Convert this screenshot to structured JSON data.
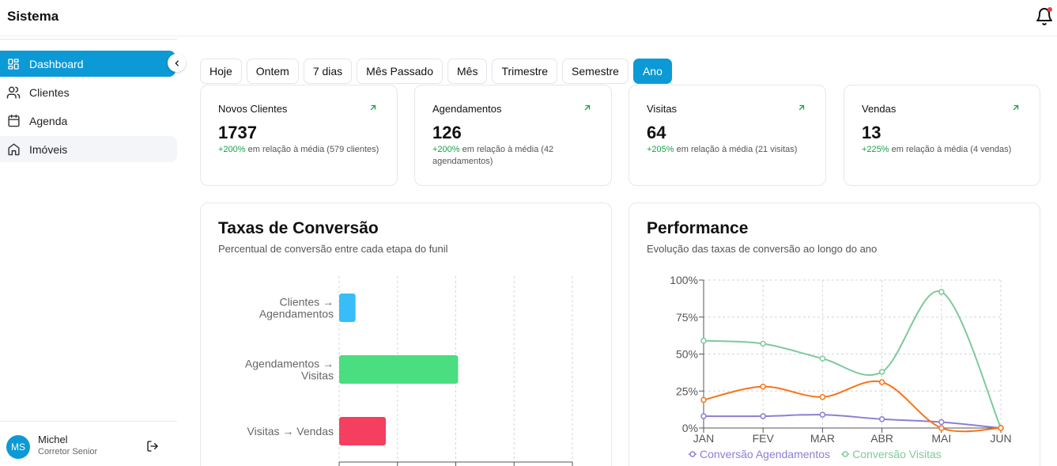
{
  "app": {
    "title": "Sistema"
  },
  "sidebar": {
    "items": [
      {
        "label": "Dashboard",
        "icon": "dashboard-icon",
        "active": true
      },
      {
        "label": "Clientes",
        "icon": "users-icon",
        "active": false
      },
      {
        "label": "Agenda",
        "icon": "calendar-icon",
        "active": false
      },
      {
        "label": "Imóveis",
        "icon": "home-icon",
        "active": false
      }
    ],
    "user": {
      "initials": "MS",
      "name": "Michel",
      "role": "Corretor Senior"
    }
  },
  "filters": {
    "items": [
      "Hoje",
      "Ontem",
      "7 dias",
      "Mês Passado",
      "Mês",
      "Trimestre",
      "Semestre",
      "Ano"
    ],
    "active": "Ano"
  },
  "stats": [
    {
      "title": "Novos Clientes",
      "value": "1737",
      "change": "+200%",
      "note": " em relação à média (579 clientes)"
    },
    {
      "title": "Agendamentos",
      "value": "126",
      "change": "+200%",
      "note": " em relação à média (42 agendamentos)"
    },
    {
      "title": "Visitas",
      "value": "64",
      "change": "+205%",
      "note": " em relação à média (21 visitas)"
    },
    {
      "title": "Vendas",
      "value": "13",
      "change": "+225%",
      "note": " em relação à média (4 vendas)"
    }
  ],
  "conversion": {
    "title": "Taxas de Conversão",
    "subtitle": "Percentual de conversão entre cada etapa do funil"
  },
  "performance": {
    "title": "Performance",
    "subtitle": "Evolução das taxas de conversão ao longo do ano"
  },
  "colors": {
    "accent": "#0b9ad6",
    "positive": "#16a34a"
  },
  "chart_data": [
    {
      "type": "bar",
      "orientation": "horizontal",
      "categories": [
        [
          "Clientes →",
          "Agendamentos"
        ],
        [
          "Agendamentos →",
          "Visitas"
        ],
        [
          "Visitas → Vendas"
        ]
      ],
      "values": [
        7,
        51,
        20
      ],
      "colors": [
        "#38bdf8",
        "#4ade80",
        "#f43f5e"
      ],
      "xlim": [
        0,
        100
      ],
      "grid": true
    },
    {
      "type": "line",
      "x": [
        "JAN",
        "FEV",
        "MAR",
        "ABR",
        "MAI",
        "JUN"
      ],
      "yticks": [
        "0%",
        "25%",
        "50%",
        "75%",
        "100%"
      ],
      "ylim": [
        0,
        100
      ],
      "grid": true,
      "legend": "bottom",
      "series": [
        {
          "name": "Conversão Agendamentos",
          "color": "#8b7fd4",
          "values": [
            8,
            8,
            9,
            6,
            4,
            0
          ]
        },
        {
          "name": "Conversão Visitas",
          "color": "#7fc99a",
          "values": [
            59,
            57,
            47,
            38,
            92,
            0
          ]
        },
        {
          "name": "",
          "color": "#f97316",
          "values": [
            19,
            28,
            21,
            31,
            0,
            0
          ]
        }
      ]
    }
  ]
}
